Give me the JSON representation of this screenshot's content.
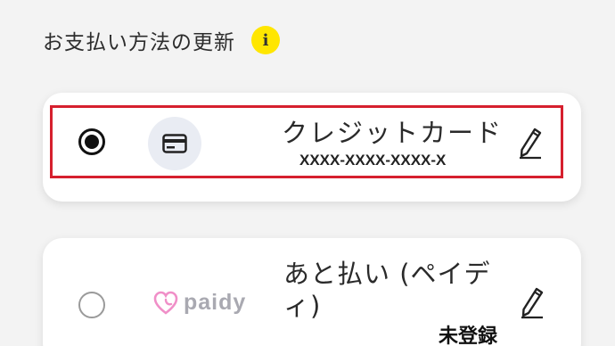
{
  "section": {
    "title": "お支払い方法の更新",
    "info_icon": "info-icon",
    "info_glyph": "i"
  },
  "payment_methods": [
    {
      "name": "クレジットカード",
      "card_number": "XXXX-XXXX-XXXX-X",
      "selected": true,
      "icon": "credit-card-icon",
      "edit_icon": "pencil-icon"
    },
    {
      "name": "あと払い (ペイディ)",
      "logo_text": "paidy",
      "status": "未登録",
      "selected": false,
      "icon": "paidy-logo",
      "edit_icon": "pencil-icon"
    }
  ],
  "colors": {
    "highlight": "#d6202e",
    "info_badge": "#ffe600",
    "paidy_pink": "#f08fc8",
    "paidy_gray": "#a9a9b1"
  }
}
